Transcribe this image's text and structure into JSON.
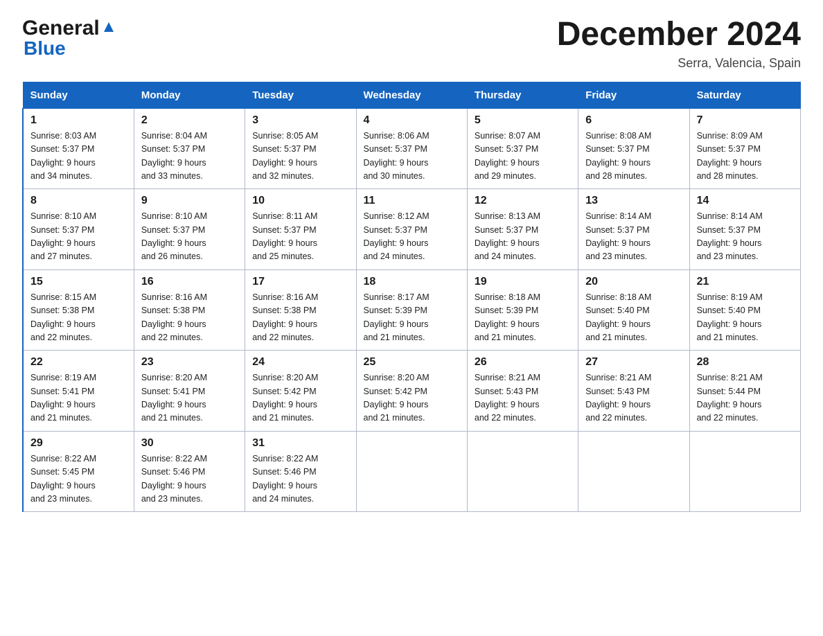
{
  "header": {
    "logo_general": "General",
    "logo_blue": "Blue",
    "title": "December 2024",
    "subtitle": "Serra, Valencia, Spain"
  },
  "weekdays": [
    "Sunday",
    "Monday",
    "Tuesday",
    "Wednesday",
    "Thursday",
    "Friday",
    "Saturday"
  ],
  "weeks": [
    [
      {
        "day": "1",
        "sunrise": "8:03 AM",
        "sunset": "5:37 PM",
        "daylight": "9 hours and 34 minutes."
      },
      {
        "day": "2",
        "sunrise": "8:04 AM",
        "sunset": "5:37 PM",
        "daylight": "9 hours and 33 minutes."
      },
      {
        "day": "3",
        "sunrise": "8:05 AM",
        "sunset": "5:37 PM",
        "daylight": "9 hours and 32 minutes."
      },
      {
        "day": "4",
        "sunrise": "8:06 AM",
        "sunset": "5:37 PM",
        "daylight": "9 hours and 30 minutes."
      },
      {
        "day": "5",
        "sunrise": "8:07 AM",
        "sunset": "5:37 PM",
        "daylight": "9 hours and 29 minutes."
      },
      {
        "day": "6",
        "sunrise": "8:08 AM",
        "sunset": "5:37 PM",
        "daylight": "9 hours and 28 minutes."
      },
      {
        "day": "7",
        "sunrise": "8:09 AM",
        "sunset": "5:37 PM",
        "daylight": "9 hours and 28 minutes."
      }
    ],
    [
      {
        "day": "8",
        "sunrise": "8:10 AM",
        "sunset": "5:37 PM",
        "daylight": "9 hours and 27 minutes."
      },
      {
        "day": "9",
        "sunrise": "8:10 AM",
        "sunset": "5:37 PM",
        "daylight": "9 hours and 26 minutes."
      },
      {
        "day": "10",
        "sunrise": "8:11 AM",
        "sunset": "5:37 PM",
        "daylight": "9 hours and 25 minutes."
      },
      {
        "day": "11",
        "sunrise": "8:12 AM",
        "sunset": "5:37 PM",
        "daylight": "9 hours and 24 minutes."
      },
      {
        "day": "12",
        "sunrise": "8:13 AM",
        "sunset": "5:37 PM",
        "daylight": "9 hours and 24 minutes."
      },
      {
        "day": "13",
        "sunrise": "8:14 AM",
        "sunset": "5:37 PM",
        "daylight": "9 hours and 23 minutes."
      },
      {
        "day": "14",
        "sunrise": "8:14 AM",
        "sunset": "5:37 PM",
        "daylight": "9 hours and 23 minutes."
      }
    ],
    [
      {
        "day": "15",
        "sunrise": "8:15 AM",
        "sunset": "5:38 PM",
        "daylight": "9 hours and 22 minutes."
      },
      {
        "day": "16",
        "sunrise": "8:16 AM",
        "sunset": "5:38 PM",
        "daylight": "9 hours and 22 minutes."
      },
      {
        "day": "17",
        "sunrise": "8:16 AM",
        "sunset": "5:38 PM",
        "daylight": "9 hours and 22 minutes."
      },
      {
        "day": "18",
        "sunrise": "8:17 AM",
        "sunset": "5:39 PM",
        "daylight": "9 hours and 21 minutes."
      },
      {
        "day": "19",
        "sunrise": "8:18 AM",
        "sunset": "5:39 PM",
        "daylight": "9 hours and 21 minutes."
      },
      {
        "day": "20",
        "sunrise": "8:18 AM",
        "sunset": "5:40 PM",
        "daylight": "9 hours and 21 minutes."
      },
      {
        "day": "21",
        "sunrise": "8:19 AM",
        "sunset": "5:40 PM",
        "daylight": "9 hours and 21 minutes."
      }
    ],
    [
      {
        "day": "22",
        "sunrise": "8:19 AM",
        "sunset": "5:41 PM",
        "daylight": "9 hours and 21 minutes."
      },
      {
        "day": "23",
        "sunrise": "8:20 AM",
        "sunset": "5:41 PM",
        "daylight": "9 hours and 21 minutes."
      },
      {
        "day": "24",
        "sunrise": "8:20 AM",
        "sunset": "5:42 PM",
        "daylight": "9 hours and 21 minutes."
      },
      {
        "day": "25",
        "sunrise": "8:20 AM",
        "sunset": "5:42 PM",
        "daylight": "9 hours and 21 minutes."
      },
      {
        "day": "26",
        "sunrise": "8:21 AM",
        "sunset": "5:43 PM",
        "daylight": "9 hours and 22 minutes."
      },
      {
        "day": "27",
        "sunrise": "8:21 AM",
        "sunset": "5:43 PM",
        "daylight": "9 hours and 22 minutes."
      },
      {
        "day": "28",
        "sunrise": "8:21 AM",
        "sunset": "5:44 PM",
        "daylight": "9 hours and 22 minutes."
      }
    ],
    [
      {
        "day": "29",
        "sunrise": "8:22 AM",
        "sunset": "5:45 PM",
        "daylight": "9 hours and 23 minutes."
      },
      {
        "day": "30",
        "sunrise": "8:22 AM",
        "sunset": "5:46 PM",
        "daylight": "9 hours and 23 minutes."
      },
      {
        "day": "31",
        "sunrise": "8:22 AM",
        "sunset": "5:46 PM",
        "daylight": "9 hours and 24 minutes."
      },
      null,
      null,
      null,
      null
    ]
  ],
  "labels": {
    "sunrise": "Sunrise:",
    "sunset": "Sunset:",
    "daylight": "Daylight:"
  }
}
